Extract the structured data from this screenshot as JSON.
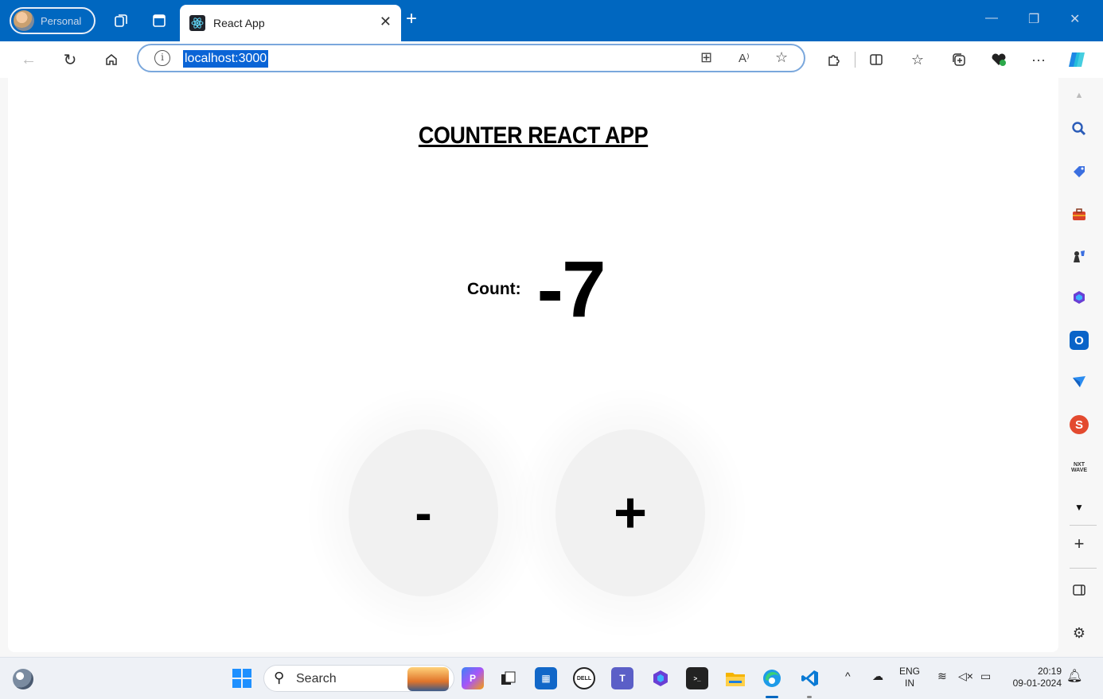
{
  "browser": {
    "profile_label": "Personal",
    "tab_title": "React App",
    "url": "localhost:3000"
  },
  "page": {
    "heading": "COUNTER REACT APP",
    "count_label": "Count:",
    "count_value": "-7",
    "decrement_label": "-",
    "increment_label": "+"
  },
  "taskbar": {
    "search_label": "Search",
    "language_top": "ENG",
    "language_bottom": "IN",
    "time": "20:19",
    "date": "09-01-2024"
  },
  "colors": {
    "titlebar": "#0067c0",
    "button_bg": "#f1f1f1",
    "url_highlight": "#0a64d6"
  },
  "icons": [
    "workspaces-icon",
    "tab-actions-icon",
    "back-icon",
    "refresh-icon",
    "home-icon",
    "site-info-icon",
    "app-available-icon",
    "read-aloud-icon",
    "favorite-star-icon",
    "extensions-icon",
    "split-screen-icon",
    "favorites-icon",
    "collections-icon",
    "browser-essentials-icon",
    "more-icon",
    "copilot-icon"
  ]
}
